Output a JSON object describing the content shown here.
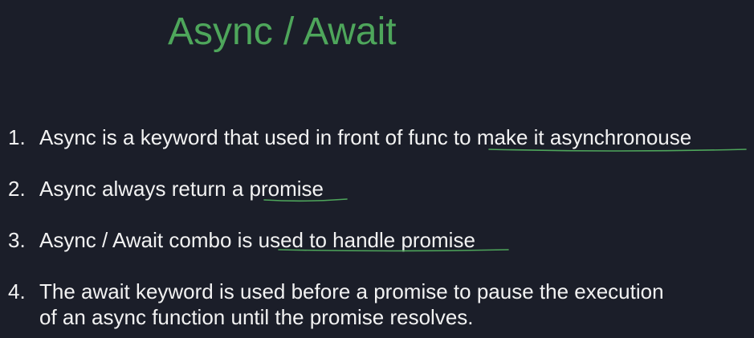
{
  "slide": {
    "title": "Async / Await",
    "title_color": "#4ea65b",
    "underline_color": "#4ea65b",
    "items": [
      {
        "number": "1.",
        "text": "Async is a keyword that used in front of func to make it asynchronouse"
      },
      {
        "number": "2.",
        "text": "Async always return a promise"
      },
      {
        "number": "3.",
        "text": "Async / Await combo is used to handle promise"
      },
      {
        "number": "4.",
        "text": "The await keyword is used before a promise to pause the execution",
        "text_line2": "of an async function until the promise resolves."
      }
    ]
  }
}
